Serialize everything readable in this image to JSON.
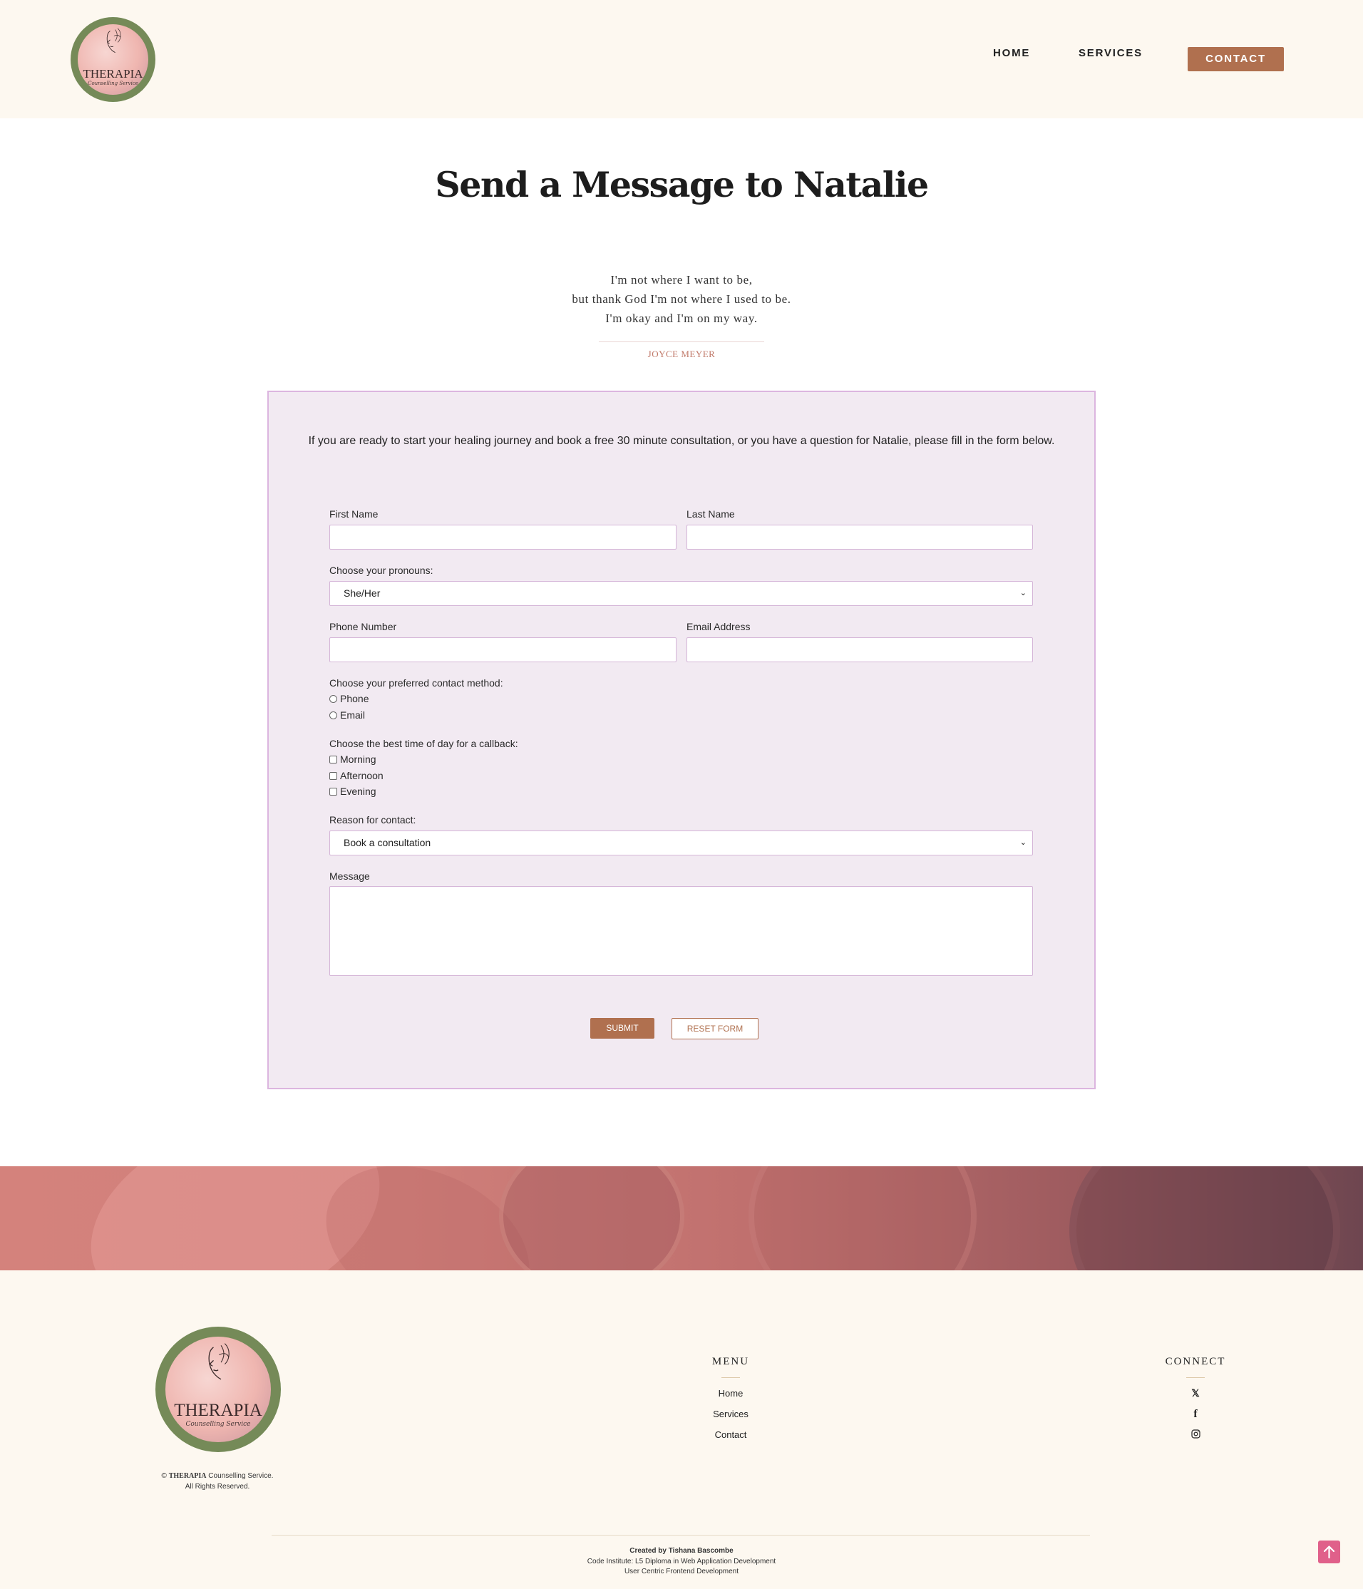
{
  "header": {
    "logo": {
      "brand": "THERAPIA",
      "tagline": "Counselling Service"
    },
    "nav": {
      "home": "HOME",
      "services": "SERVICES",
      "contact": "CONTACT"
    }
  },
  "page_title": "Send a Message to Natalie",
  "quote": {
    "lines": [
      "I'm not where I want to be,",
      "but thank God I'm not where I used to be.",
      "I'm okay and I'm on my way."
    ],
    "author": "JOYCE MEYER"
  },
  "form": {
    "intro": "If you are ready to start your healing journey and book a free 30 minute consultation, or you have a question for Natalie, please fill in the form below.",
    "first_name_label": "First Name",
    "last_name_label": "Last Name",
    "pronouns_label": "Choose your pronouns:",
    "pronouns_value": "She/Her",
    "phone_label": "Phone Number",
    "email_label": "Email Address",
    "contact_method_label": "Choose your preferred contact method:",
    "contact_methods": [
      "Phone",
      "Email"
    ],
    "callback_label": "Choose the best time of day for a callback:",
    "callback_times": [
      "Morning",
      "Afternoon",
      "Evening"
    ],
    "reason_label": "Reason for contact:",
    "reason_value": "Book a consultation",
    "message_label": "Message",
    "submit_label": "SUBMIT",
    "reset_label": "RESET FORM"
  },
  "footer": {
    "logo": {
      "brand": "THERAPIA",
      "tagline": "Counselling Service"
    },
    "copyright_symbol": "©",
    "copyright_brand": "THERAPIA",
    "copyright_rest": "Counselling Service.",
    "rights": "All Rights Reserved.",
    "menu_heading": "MENU",
    "menu_links": [
      "Home",
      "Services",
      "Contact"
    ],
    "connect_heading": "CONNECT",
    "social_icons": [
      "x-icon",
      "facebook-icon",
      "instagram-icon"
    ],
    "credits": [
      "Created by Tishana Bascombe",
      "Code Institute: L5 Diploma in Web Application Development",
      "User Centric Frontend Development"
    ]
  },
  "colors": {
    "accent": "#b0704f",
    "panel_bg": "#f2eaf2",
    "panel_border": "#dcb5df",
    "cream": "#fdf8f0",
    "to_top": "#e0608a"
  }
}
